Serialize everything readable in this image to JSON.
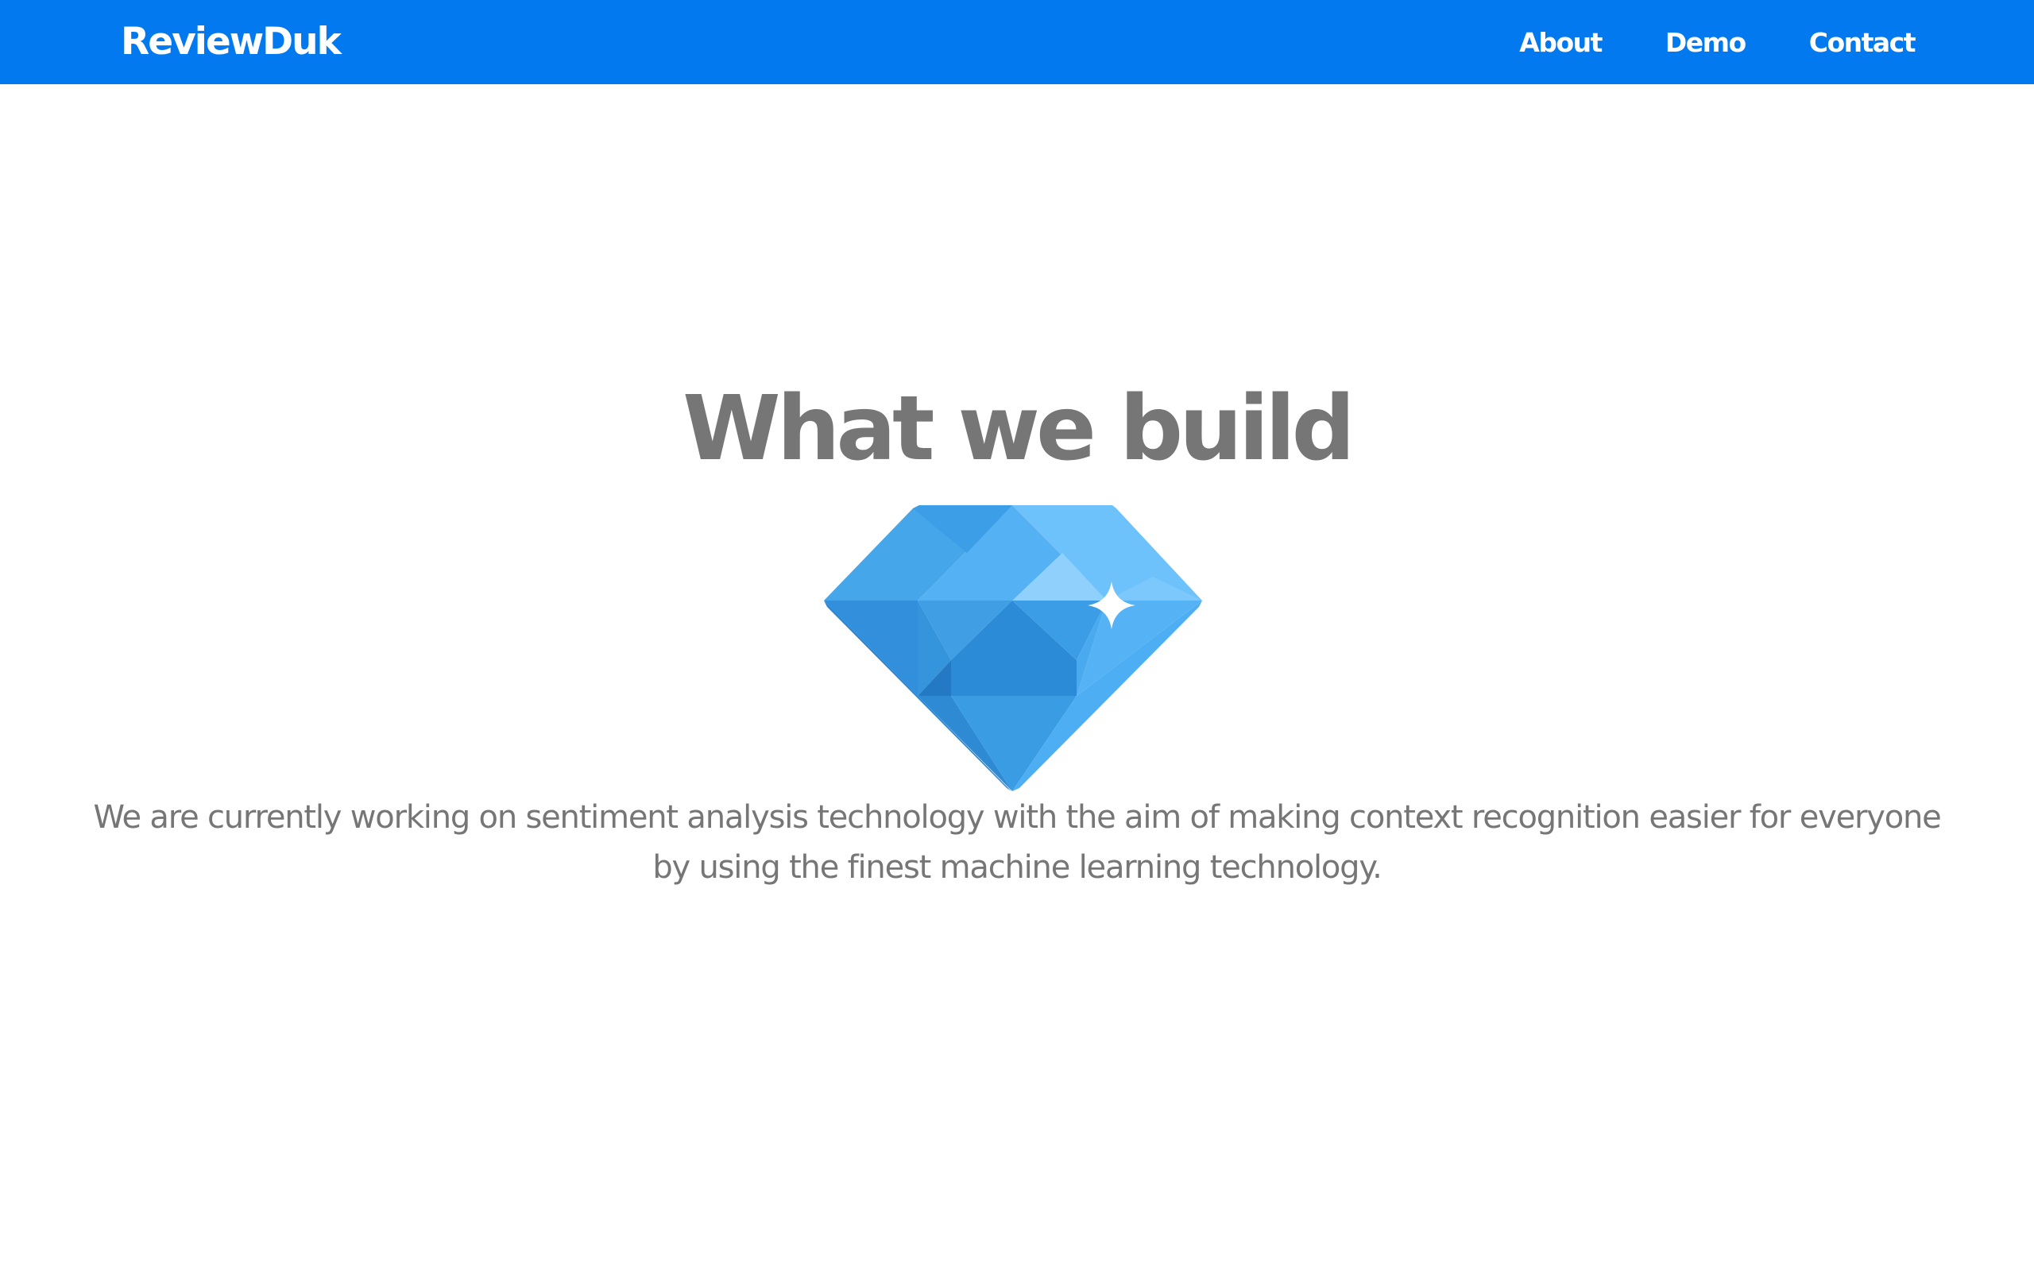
{
  "navbar": {
    "brand": "ReviewDuk",
    "links": [
      {
        "label": "About"
      },
      {
        "label": "Demo"
      },
      {
        "label": "Contact"
      }
    ],
    "background_color": "#0379ef"
  },
  "main": {
    "heading": "What we build",
    "icon": "diamond-icon",
    "description": "We are currently working on sentiment analysis technology with the aim of making context recognition easier for everyone by using the finest machine learning technology."
  },
  "colors": {
    "text_gray": "#767676",
    "diamond_blue": "#3a9de8"
  }
}
